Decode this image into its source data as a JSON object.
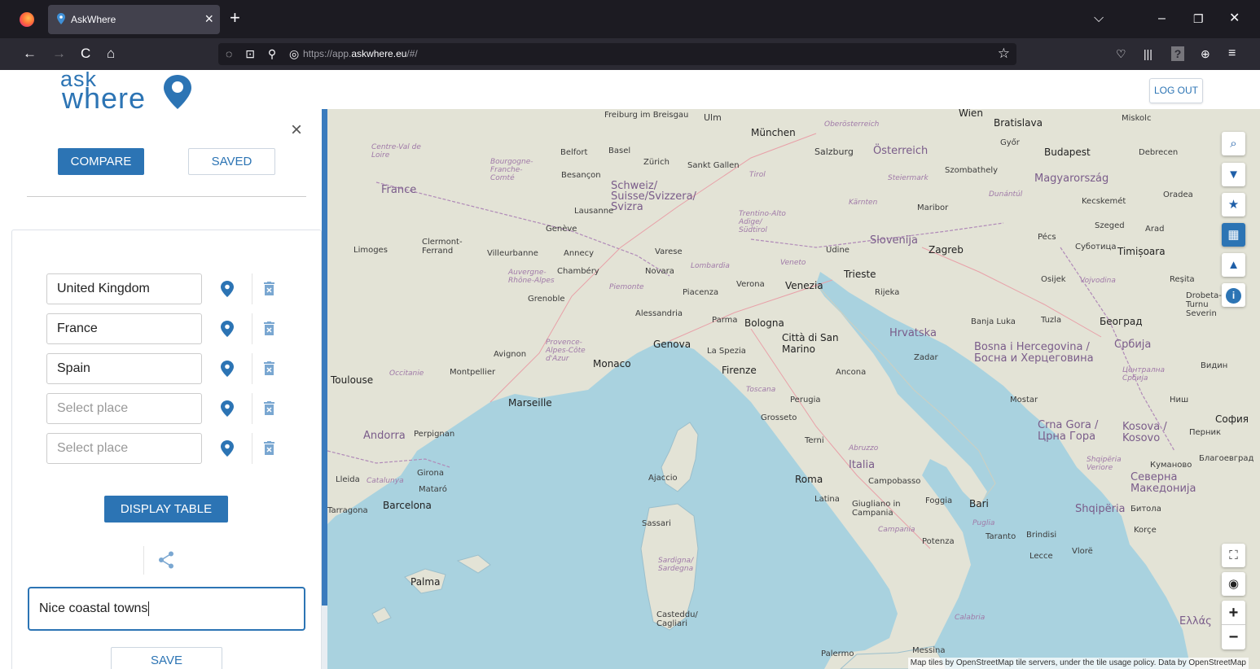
{
  "browser": {
    "tab_title": "AskWhere",
    "tab_close": "×",
    "new_tab": "+",
    "url_prefix": "https://app.",
    "url_domain": "askwhere.eu",
    "url_suffix": "/#/",
    "controls": {
      "dropdown": "⌵",
      "minimize": "–",
      "restore": "❐",
      "close": "✕"
    },
    "nav": {
      "back": "←",
      "forward": "→",
      "reload": "C",
      "home": "⌂"
    }
  },
  "header": {
    "logo_top": "ask",
    "logo_bottom": "where",
    "logout_label": "LOG OUT"
  },
  "panel": {
    "close": "×",
    "compare_label": "COMPARE",
    "saved_label": "SAVED",
    "places": [
      {
        "value": "United Kingdom",
        "placeholder": false
      },
      {
        "value": "France",
        "placeholder": false
      },
      {
        "value": "Spain",
        "placeholder": false
      },
      {
        "value": "Select place",
        "placeholder": true
      },
      {
        "value": "Select place",
        "placeholder": true
      }
    ],
    "display_table_label": "DISPLAY TABLE",
    "note_value": "Nice coastal towns",
    "save_label": "SAVE"
  },
  "map": {
    "attribution": "Map tiles by OpenStreetMap tile servers, under the tile usage policy. Data by OpenStreetMap",
    "controls": {
      "zoom_in": "+",
      "zoom_out": "−"
    },
    "colors": {
      "sea": "#a9d2df",
      "land": "#e3e3d6",
      "accent": "#2c74b4"
    },
    "labels": [
      {
        "t": "Freiburg im Breisgau",
        "c": ""
      },
      {
        "t": "Ulm",
        "c": ""
      },
      {
        "t": "München",
        "c": "big"
      },
      {
        "t": "Wien",
        "c": "big"
      },
      {
        "t": "Bratislava",
        "c": "big"
      },
      {
        "t": "Miskolc",
        "c": ""
      },
      {
        "t": "Oberösterreich",
        "c": "region"
      },
      {
        "t": "Österreich",
        "c": "country"
      },
      {
        "t": "Salzburg",
        "c": ""
      },
      {
        "t": "Győr",
        "c": ""
      },
      {
        "t": "Budapest",
        "c": "big"
      },
      {
        "t": "Debrecen",
        "c": ""
      },
      {
        "t": "Centre-Val de Loire",
        "c": "region"
      },
      {
        "t": "Belfort",
        "c": ""
      },
      {
        "t": "Basel",
        "c": ""
      },
      {
        "t": "Zürich",
        "c": ""
      },
      {
        "t": "Sankt Gallen",
        "c": ""
      },
      {
        "t": "Szombathely",
        "c": ""
      },
      {
        "t": "Magyarország",
        "c": "country"
      },
      {
        "t": "Bourgogne-Franche-Comté",
        "c": "region"
      },
      {
        "t": "Besançon",
        "c": ""
      },
      {
        "t": "Schweiz/ Suisse/Svizzera/ Svizra",
        "c": "country"
      },
      {
        "t": "Tirol",
        "c": "region"
      },
      {
        "t": "Steiermark",
        "c": "region"
      },
      {
        "t": "France",
        "c": "country"
      },
      {
        "t": "Dunántúl",
        "c": "region"
      },
      {
        "t": "Kecskemét",
        "c": ""
      },
      {
        "t": "Oradea",
        "c": ""
      },
      {
        "t": "Lausanne",
        "c": ""
      },
      {
        "t": "Kärnten",
        "c": "region"
      },
      {
        "t": "Maribor",
        "c": ""
      },
      {
        "t": "Genève",
        "c": ""
      },
      {
        "t": "Trentino-Alto Adige/ Südtirol",
        "c": "region"
      },
      {
        "t": "Szeged",
        "c": ""
      },
      {
        "t": "Arad",
        "c": ""
      },
      {
        "t": "Clermont-Ferrand",
        "c": ""
      },
      {
        "t": "Limoges",
        "c": ""
      },
      {
        "t": "Villeurbanne",
        "c": ""
      },
      {
        "t": "Annecy",
        "c": ""
      },
      {
        "t": "Varese",
        "c": ""
      },
      {
        "t": "Slovenija",
        "c": "country"
      },
      {
        "t": "Pécs",
        "c": ""
      },
      {
        "t": "Суботица",
        "c": ""
      },
      {
        "t": "Timișoara",
        "c": "big"
      },
      {
        "t": "Udine",
        "c": ""
      },
      {
        "t": "Zagreb",
        "c": "big"
      },
      {
        "t": "Lombardia",
        "c": "region"
      },
      {
        "t": "Veneto",
        "c": "region"
      },
      {
        "t": "Auvergne-Rhône-Alpes",
        "c": "region"
      },
      {
        "t": "Chambéry",
        "c": ""
      },
      {
        "t": "Novara",
        "c": ""
      },
      {
        "t": "Trieste",
        "c": "big"
      },
      {
        "t": "Osijek",
        "c": ""
      },
      {
        "t": "Vojvodina",
        "c": "region"
      },
      {
        "t": "Reșita",
        "c": ""
      },
      {
        "t": "Piemonte",
        "c": "region"
      },
      {
        "t": "Verona",
        "c": ""
      },
      {
        "t": "Venezia",
        "c": "big"
      },
      {
        "t": "Piacenza",
        "c": ""
      },
      {
        "t": "Rijeka",
        "c": ""
      },
      {
        "t": "Grenoble",
        "c": ""
      },
      {
        "t": "Alessandria",
        "c": ""
      },
      {
        "t": "Drobeta-Turnu Severin",
        "c": ""
      },
      {
        "t": "Parma",
        "c": ""
      },
      {
        "t": "Bologna",
        "c": "big"
      },
      {
        "t": "Banja Luka",
        "c": ""
      },
      {
        "t": "Tuzla",
        "c": ""
      },
      {
        "t": "Београд",
        "c": "big"
      },
      {
        "t": "Hrvatska",
        "c": "country"
      },
      {
        "t": "Città di San Marino",
        "c": "big"
      },
      {
        "t": "Provence-Alpes-Côte d'Azur",
        "c": "region"
      },
      {
        "t": "Genova",
        "c": "big"
      },
      {
        "t": "La Spezia",
        "c": ""
      },
      {
        "t": "Avignon",
        "c": ""
      },
      {
        "t": "Monaco",
        "c": "big"
      },
      {
        "t": "Zadar",
        "c": ""
      },
      {
        "t": "Bosna i Hercegovina / Босна и Херцеговина",
        "c": "country"
      },
      {
        "t": "Србија",
        "c": "country"
      },
      {
        "t": "Toulouse",
        "c": "big"
      },
      {
        "t": "Occitanie",
        "c": "region"
      },
      {
        "t": "Montpellier",
        "c": ""
      },
      {
        "t": "Firenze",
        "c": "big"
      },
      {
        "t": "Ancona",
        "c": ""
      },
      {
        "t": "Видин",
        "c": ""
      },
      {
        "t": "Централна Србија",
        "c": "region"
      },
      {
        "t": "Toscana",
        "c": "region"
      },
      {
        "t": "Perugia",
        "c": ""
      },
      {
        "t": "Mostar",
        "c": ""
      },
      {
        "t": "Ниш",
        "c": ""
      },
      {
        "t": "Marseille",
        "c": "big"
      },
      {
        "t": "Grosseto",
        "c": ""
      },
      {
        "t": "Crna Gora / Црна Гора",
        "c": "country"
      },
      {
        "t": "Kosova / Kosovo",
        "c": "country"
      },
      {
        "t": "София",
        "c": "big"
      },
      {
        "t": "Перник",
        "c": ""
      },
      {
        "t": "Andorra",
        "c": "country"
      },
      {
        "t": "Perpignan",
        "c": ""
      },
      {
        "t": "Terni",
        "c": ""
      },
      {
        "t": "Abruzzo",
        "c": "region"
      },
      {
        "t": "Italia",
        "c": "country"
      },
      {
        "t": "Shqipëria Veriore",
        "c": "region"
      },
      {
        "t": "Куманово",
        "c": ""
      },
      {
        "t": "Благоевград",
        "c": ""
      },
      {
        "t": "Северна Македонија",
        "c": "country"
      },
      {
        "t": "Lleida",
        "c": ""
      },
      {
        "t": "Catalunya",
        "c": "region"
      },
      {
        "t": "Girona",
        "c": ""
      },
      {
        "t": "Ajaccio",
        "c": ""
      },
      {
        "t": "Roma",
        "c": "big"
      },
      {
        "t": "Campobasso",
        "c": ""
      },
      {
        "t": "Mataró",
        "c": ""
      },
      {
        "t": "Tarragona",
        "c": ""
      },
      {
        "t": "Barcelona",
        "c": "big"
      },
      {
        "t": "Latina",
        "c": ""
      },
      {
        "t": "Giugliano in Campania",
        "c": ""
      },
      {
        "t": "Foggia",
        "c": ""
      },
      {
        "t": "Bari",
        "c": "big"
      },
      {
        "t": "Shqipëria",
        "c": "country"
      },
      {
        "t": "Битола",
        "c": ""
      },
      {
        "t": "Campania",
        "c": "region"
      },
      {
        "t": "Puglia",
        "c": "region"
      },
      {
        "t": "Potenza",
        "c": ""
      },
      {
        "t": "Taranto",
        "c": ""
      },
      {
        "t": "Brindisi",
        "c": ""
      },
      {
        "t": "Korçe",
        "c": ""
      },
      {
        "t": "Sassari",
        "c": ""
      },
      {
        "t": "Lecce",
        "c": ""
      },
      {
        "t": "Vlorë",
        "c": ""
      },
      {
        "t": "Palma",
        "c": "big"
      },
      {
        "t": "Sardigna/ Sardegna",
        "c": "region"
      },
      {
        "t": "Ελλάς",
        "c": "country"
      },
      {
        "t": "Casteddu/ Cagliari",
        "c": ""
      },
      {
        "t": "Calabria",
        "c": "region"
      },
      {
        "t": "Palermo",
        "c": ""
      },
      {
        "t": "Messina",
        "c": ""
      }
    ]
  }
}
